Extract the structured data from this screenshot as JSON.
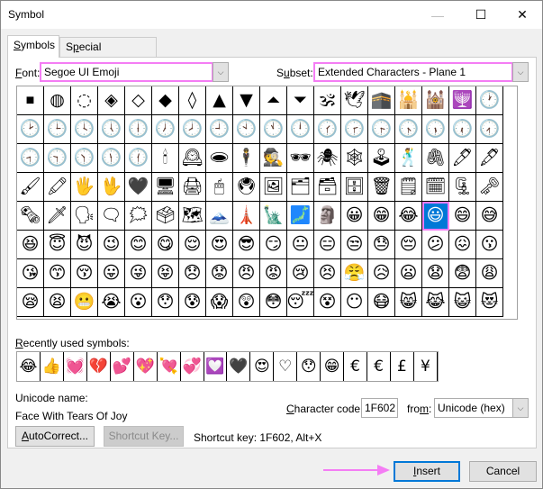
{
  "window": {
    "title": "Symbol",
    "minimize_icon": "—",
    "maximize_icon": "☐",
    "close_icon": "✕"
  },
  "tabs": [
    {
      "label_u": "S",
      "label_rest": "ymbols",
      "active": true
    },
    {
      "label_pre": "S",
      "label_u": "p",
      "label_rest": "ecial Characters",
      "active": false
    }
  ],
  "font": {
    "label_u": "F",
    "label_rest": "ont:",
    "value": "Segoe UI Emoji"
  },
  "subset": {
    "label_pre": "S",
    "label_u": "u",
    "label_rest": "bset:",
    "value": "Extended Characters - Plane 1"
  },
  "dropdown_icon": "⌵",
  "scroll": {
    "up_icon": "⌃",
    "down_icon": "⌄"
  },
  "symbol_grid": {
    "selected_index": 87,
    "symbols": [
      "⏹",
      "◍",
      "◌",
      "◈",
      "◇",
      "◆",
      "◊",
      "▲",
      "▼",
      "⏶",
      "⏷",
      "🕉",
      "🕊",
      "🕋",
      "🕌",
      "🕍",
      "🕎",
      "🕐",
      "🕑",
      "🕒",
      "🕓",
      "🕔",
      "🕕",
      "🕖",
      "🕗",
      "🕘",
      "🕙",
      "🕚",
      "🕛",
      "🕜",
      "🕝",
      "🕞",
      "🕟",
      "🕠",
      "🕡",
      "🕢",
      "🕣",
      "🕤",
      "🕥",
      "🕦",
      "🕧",
      "🕯",
      "🕰",
      "🕳",
      "🕴",
      "🕵",
      "🕶",
      "🕷",
      "🕸",
      "🕹",
      "🕺",
      "🖇",
      "🖊",
      "🖋",
      "🖌",
      "🖍",
      "🖐",
      "🖖",
      "🖤",
      "🖥",
      "🖨",
      "🖱",
      "🖲",
      "🖼",
      "🗂",
      "🗃",
      "🗄",
      "🗑",
      "🗒",
      "🗓",
      "🗜",
      "🗝",
      "🗞",
      "🗡",
      "🗣",
      "🗨",
      "🗯",
      "🗳",
      "🗺",
      "🗻",
      "🗼",
      "🗽",
      "🗾",
      "🗿",
      "😀",
      "😁",
      "😂",
      "😃",
      "😄",
      "😅",
      "😆",
      "😇",
      "😈",
      "😉",
      "😊",
      "😋",
      "😌",
      "😍",
      "😎",
      "😏",
      "😐",
      "😑",
      "😒",
      "😓",
      "😔",
      "😕",
      "😖",
      "😗",
      "😘",
      "😙",
      "😚",
      "😛",
      "😜",
      "😝",
      "😞",
      "😟",
      "😠",
      "😡",
      "😢",
      "😣",
      "😤",
      "😥",
      "😦",
      "😧",
      "😨",
      "😩",
      "😪",
      "😫",
      "😬",
      "😭",
      "😮",
      "😯",
      "😰",
      "😱",
      "😲",
      "😳",
      "😴",
      "😵",
      "😶",
      "😷",
      "😸",
      "😹",
      "😺",
      "😻"
    ]
  },
  "recent": {
    "label_u": "R",
    "label_rest": "ecently used symbols:",
    "symbols": [
      "😂",
      "👍",
      "💓",
      "💔",
      "💕",
      "💖",
      "💘",
      "💞",
      "💟",
      "🖤",
      "😍",
      "♡",
      "😯",
      "😁",
      "€",
      "€",
      "£",
      "¥"
    ]
  },
  "unicode_name": {
    "label": "Unicode name:",
    "value": "Face With Tears Of Joy"
  },
  "character_code": {
    "label_u": "C",
    "label_rest": "haracter code:",
    "value": "1F602"
  },
  "from": {
    "label_pre": "fro",
    "label_u": "m",
    "label_rest": ":",
    "value": "Unicode (hex)"
  },
  "buttons": {
    "autocorrect": {
      "label_u": "A",
      "label_rest": "utoCorrect..."
    },
    "shortcut_key": "Shortcut Key...",
    "insert": {
      "label_u": "I",
      "label_rest": "nsert"
    },
    "cancel": "Cancel"
  },
  "shortcut_text": "Shortcut key: 1F602, Alt+X",
  "colors": {
    "accent": "#0078d7",
    "highlight": "#f47df4"
  }
}
